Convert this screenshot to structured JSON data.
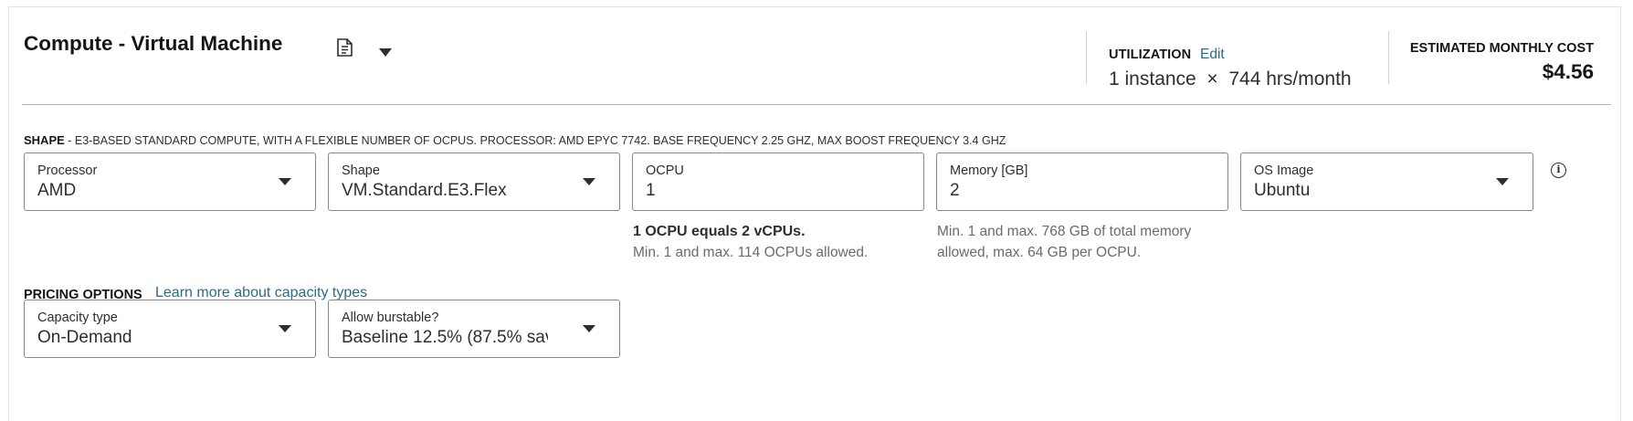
{
  "header": {
    "title": "Compute - Virtual Machine",
    "copy_icon": "copy-icon",
    "menu_icon": "caret-down-icon"
  },
  "utilization": {
    "label": "UTILIZATION",
    "edit_label": "Edit",
    "value": "1 instance  ×  744 hrs/month"
  },
  "cost": {
    "label": "ESTIMATED MONTHLY COST",
    "value": "$4.56"
  },
  "shape_section": {
    "label": "SHAPE",
    "description": " - E3-BASED STANDARD COMPUTE, WITH A FLEXIBLE NUMBER OF OCPUS. PROCESSOR: AMD EPYC 7742. BASE FREQUENCY 2.25 GHZ, MAX BOOST FREQUENCY 3.4 GHZ"
  },
  "fields": {
    "processor": {
      "label": "Processor",
      "value": "AMD"
    },
    "shape": {
      "label": "Shape",
      "value": "VM.Standard.E3.Flex"
    },
    "ocpu": {
      "label": "OCPU",
      "value": "1"
    },
    "memory": {
      "label": "Memory [GB]",
      "value": "2"
    },
    "os_image": {
      "label": "OS Image",
      "value": "Ubuntu"
    }
  },
  "help": {
    "ocpu_strong": "1 OCPU equals 2 vCPUs.",
    "ocpu_text": "Min. 1 and max. 114 OCPUs allowed.",
    "memory_line1": "Min. 1 and max. 768 GB of total memory",
    "memory_line2": "allowed, max. 64 GB per OCPU."
  },
  "pricing": {
    "label": "PRICING OPTIONS",
    "link": "Learn more about capacity types",
    "capacity_type": {
      "label": "Capacity type",
      "value": "On-Demand"
    },
    "burstable": {
      "label": "Allow burstable?",
      "value": "Baseline 12.5% (87.5% sav"
    }
  },
  "colors": {
    "link": "#2b6c89",
    "text": "#312d2a",
    "border": "#8b8680"
  }
}
